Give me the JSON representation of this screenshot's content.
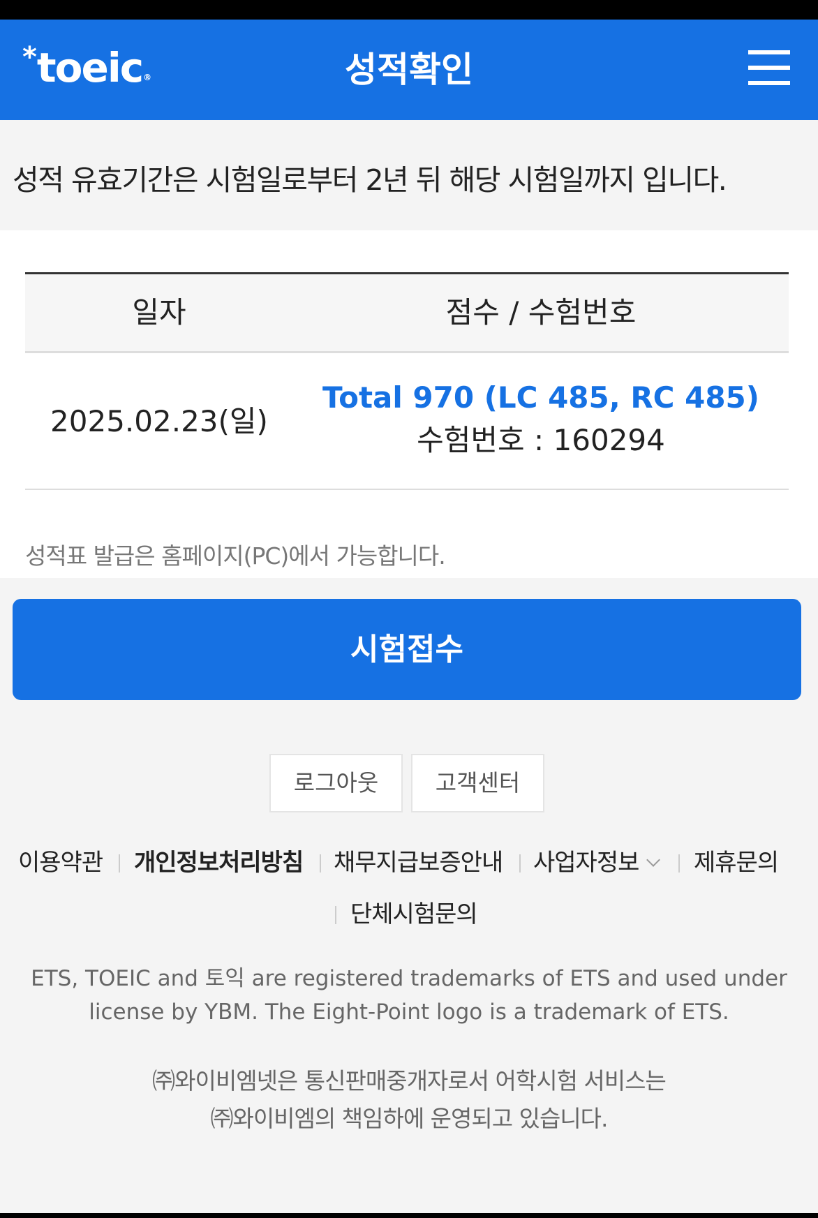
{
  "header": {
    "logo_star": "*",
    "logo_text": "toeic",
    "logo_reg": "®",
    "title": "성적확인",
    "menu_icon": "hamburger-menu-icon"
  },
  "notice": "성적 유효기간은 시험일로부터 2년 뒤 해당 시험일까지 입니다.",
  "table": {
    "headers": [
      "일자",
      "점수 / 수험번호"
    ],
    "rows": [
      {
        "date": "2025.02.23(일)",
        "total": "Total 970 (LC 485, RC 485)",
        "exam_number": "수험번호 : 160294"
      }
    ]
  },
  "card_note": "성적표 발급은 홈페이지(PC)에서 가능합니다.",
  "register_button": "시험접수",
  "small_buttons": {
    "logout": "로그아웃",
    "customer_center": "고객센터"
  },
  "footer_links": [
    "이용약관",
    "개인정보처리방침",
    "채무지급보증안내",
    "사업자정보",
    "제휴문의",
    "단체시험문의"
  ],
  "trademark": "ETS, TOEIC and 토익 are registered trademarks of ETS and used under license by YBM. The Eight-Point logo is a trademark of ETS.",
  "company_line1": "㈜와이비엠넷은 통신판매중개자로서 어학시험 서비스는",
  "company_line2": "㈜와이비엠의 책임하에 운영되고 있습니다.",
  "colors": {
    "brand_blue": "#1671e3",
    "background": "#f4f4f4"
  }
}
